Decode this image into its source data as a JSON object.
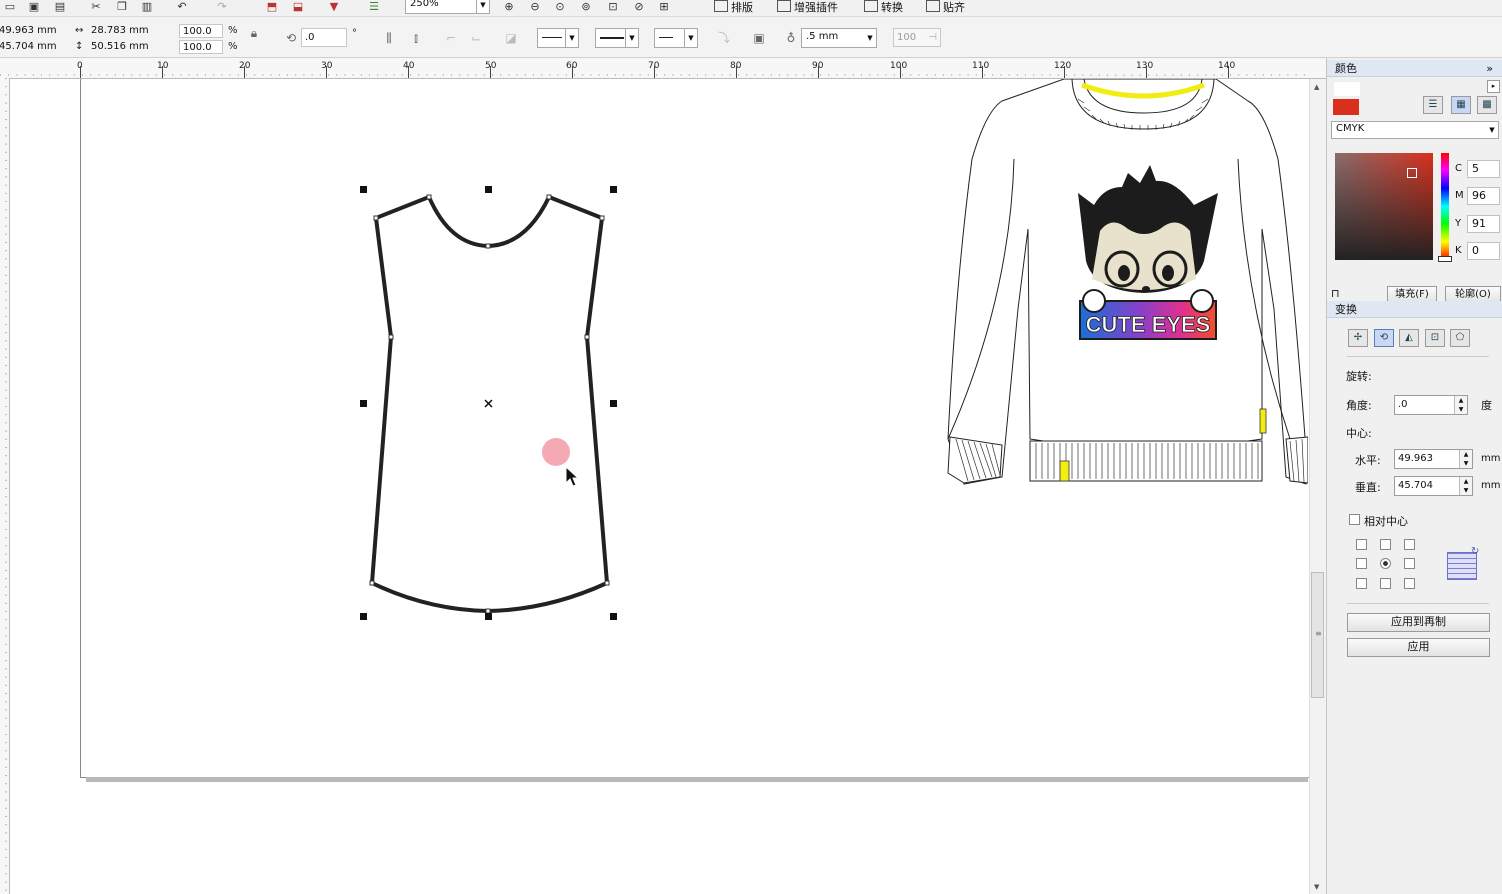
{
  "toolbar": {
    "zoom": "250%",
    "menus": [
      "排版",
      "增强插件",
      "转换",
      "贴齐"
    ]
  },
  "propbar": {
    "pos_x": "49.963 mm",
    "pos_y": "45.704 mm",
    "width": "28.783 mm",
    "height": "50.516 mm",
    "scale_x": "100.0",
    "scale_y": "100.0",
    "percent": "%",
    "angle": ".0",
    "degree": "°",
    "outline_width": ".5 mm",
    "transparency": "100"
  },
  "ruler": {
    "ticks": [
      "0",
      "10",
      "20",
      "30",
      "40",
      "50",
      "60",
      "70",
      "80",
      "90",
      "100",
      "110",
      "120",
      "130",
      "140"
    ]
  },
  "artwork": {
    "logo_text": "CUTE EYES"
  },
  "color_docker": {
    "title": "颜色",
    "model": "CMYK",
    "c_label": "C",
    "c_value": "5",
    "m_label": "M",
    "m_value": "96",
    "y_label": "Y",
    "y_value": "91",
    "k_label": "K",
    "k_value": "0",
    "fill_button": "填充(F)",
    "outline_button": "轮廓(O)",
    "current_color": "#d9301e"
  },
  "transform_docker": {
    "title": "变换",
    "rotate_label": "旋转:",
    "angle_label": "角度:",
    "angle_value": ".0",
    "degree_unit": "度",
    "center_label": "中心:",
    "horizontal_label": "水平:",
    "horizontal_value": "49.963",
    "vertical_label": "垂直:",
    "vertical_value": "45.704",
    "unit": "mm",
    "relative_center_label": "相对中心",
    "apply_duplicate_button": "应用到再制",
    "apply_button": "应用"
  }
}
